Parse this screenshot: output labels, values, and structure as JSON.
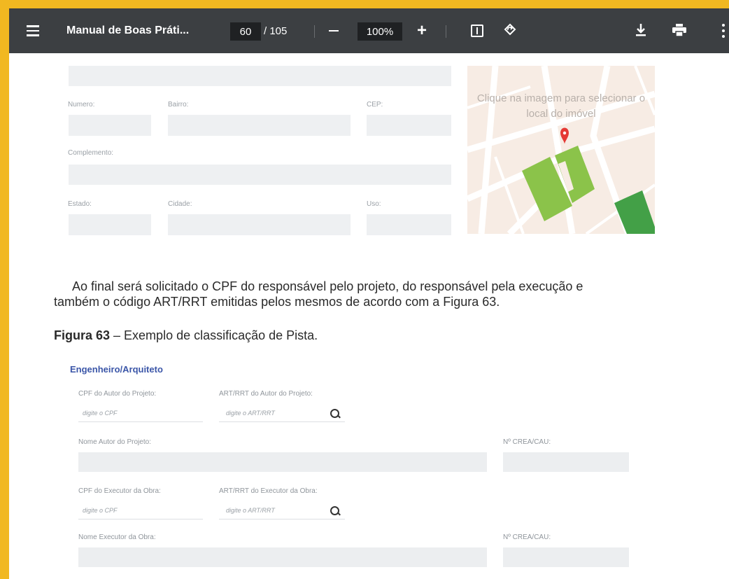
{
  "toolbar": {
    "title": "Manual de Boas Práti...",
    "page_current": "60",
    "page_total": "/ 105",
    "zoom": "100%",
    "zoom_out_icon": "minus-icon",
    "zoom_in_label": "+",
    "icons": [
      "menu-icon",
      "fit-page-icon",
      "rotate-icon",
      "download-icon",
      "print-icon",
      "more-vert-icon"
    ]
  },
  "address_form": {
    "numero_label": "Numero:",
    "bairro_label": "Bairro:",
    "cep_label": "CEP:",
    "complemento_label": "Complemento:",
    "estado_label": "Estado:",
    "cidade_label": "Cidade:",
    "uso_label": "Uso:",
    "map_hint": "Clique na imagem para selecionar o local do imóvel"
  },
  "body": {
    "paragraph_line1": "Ao final será solicitado o CPF do responsável pelo projeto, do responsável pela execução e",
    "paragraph_line2": "também o código ART/RRT emitidas pelos mesmos de acordo com a Figura 63.",
    "caption_bold": "Figura 63",
    "caption_rest": " – Exemplo de classificação de Pista."
  },
  "figure_form": {
    "title": "Engenheiro/Arquiteto",
    "cpf_autor_label": "CPF do Autor do Projeto:",
    "cpf_autor_placeholder": "digite o CPF",
    "art_autor_label": "ART/RRT do Autor do Projeto:",
    "art_autor_placeholder": "digite o ART/RRT",
    "nome_autor_label": "Nome Autor do Projeto:",
    "crea_autor_label": "Nº CREA/CAU:",
    "cpf_exec_label": "CPF do Executor da Obra:",
    "cpf_exec_placeholder": "digite o CPF",
    "art_exec_label": "ART/RRT do Executor da Obra:",
    "art_exec_placeholder": "digite o ART/RRT",
    "nome_exec_label": "Nome Executor da Obra:",
    "crea_exec_label": "Nº CREA/CAU:"
  },
  "colors": {
    "frame": "#f1b821",
    "toolbar": "#3c3f42",
    "map_pin": "#e53935",
    "link": "#3b56a8"
  }
}
